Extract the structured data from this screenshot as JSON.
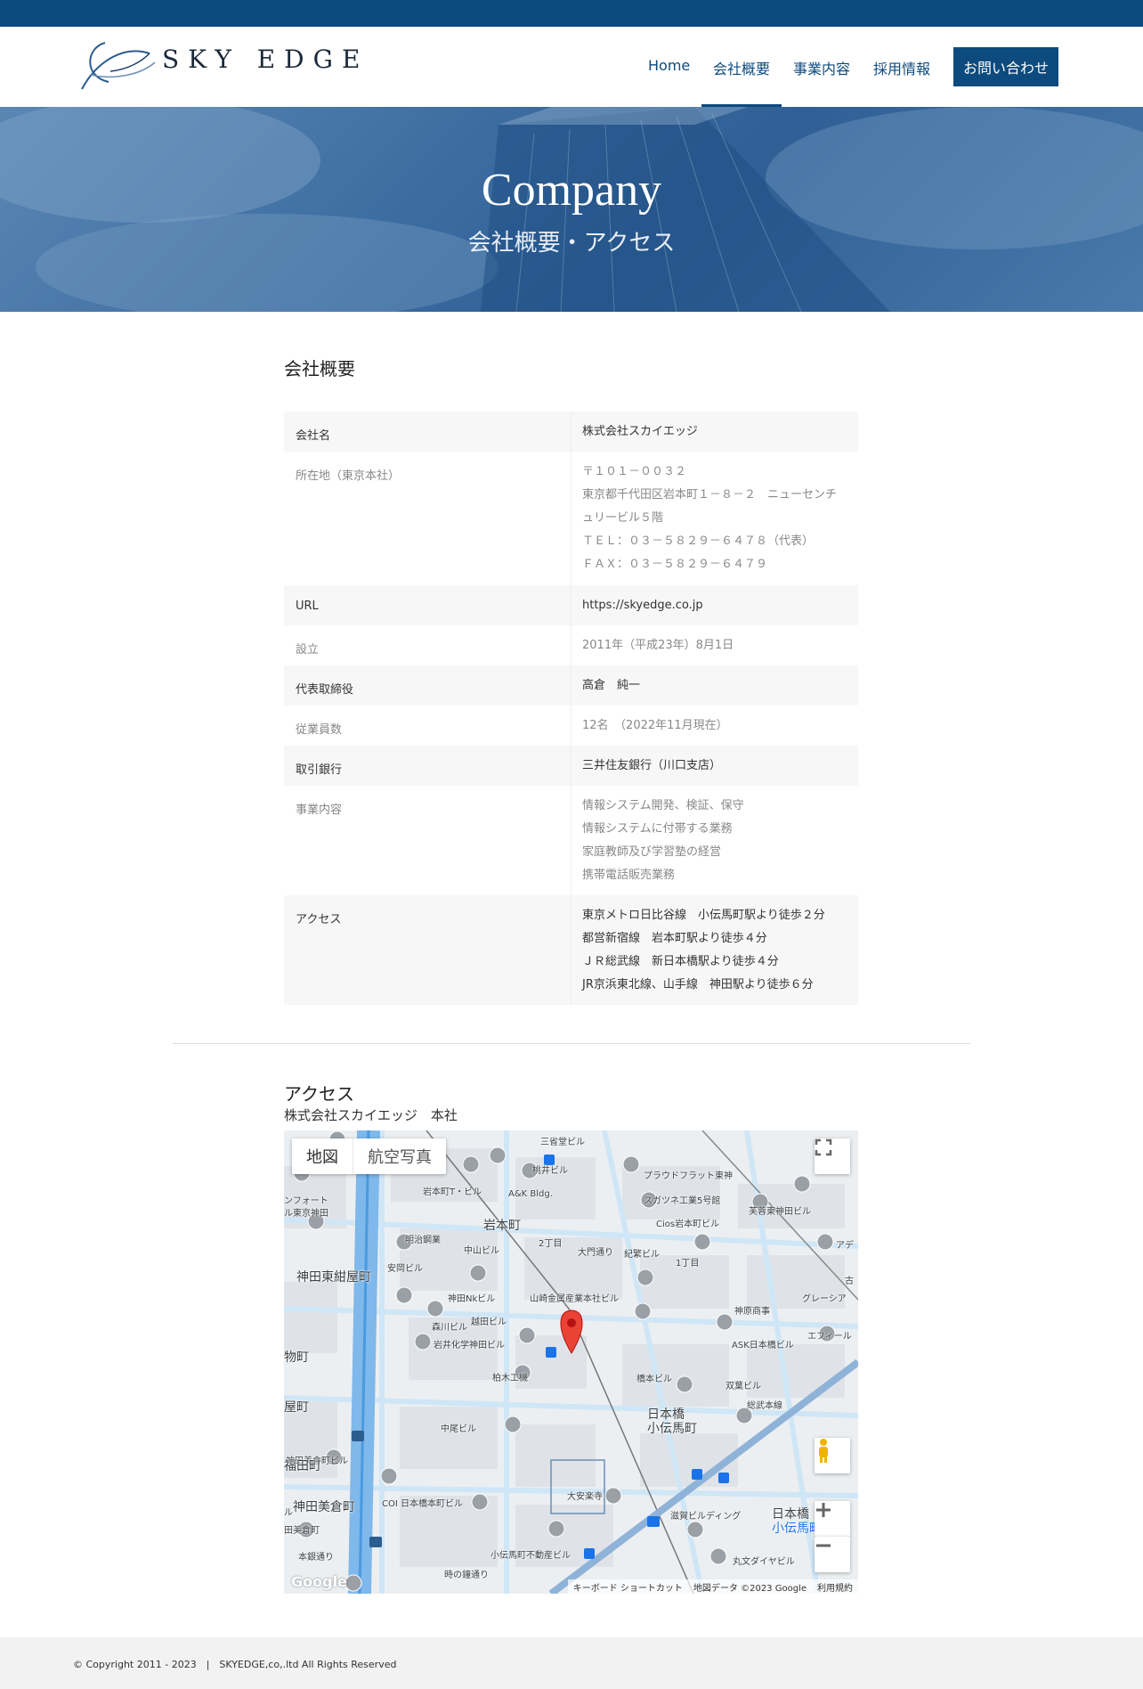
{
  "header": {
    "brand": "SKY EDGE",
    "nav": [
      "Home",
      "会社概要",
      "事業内容",
      "採用情報"
    ],
    "cta": "お問い合わせ"
  },
  "hero": {
    "title": "Company",
    "subtitle": "会社概要・アクセス"
  },
  "overview": {
    "title": "会社概要",
    "rows": [
      {
        "key": "会社名",
        "lines": [
          "株式会社スカイエッジ"
        ]
      },
      {
        "key": "所在地（東京本社）",
        "lines": [
          "〒１０１－００３２",
          "東京都千代田区岩本町１－８－２　ニューセンチ",
          "ュリービル５階",
          "ＴＥＬ：０３－５８２９－６４７８（代表）",
          "ＦＡＸ：０３－５８２９－６４７９"
        ]
      },
      {
        "key": "URL",
        "lines": [
          "https://skyedge.co.jp"
        ]
      },
      {
        "key": "設立",
        "lines": [
          "2011年（平成23年）8月1日"
        ]
      },
      {
        "key": "代表取締役",
        "lines": [
          "高倉　純一"
        ]
      },
      {
        "key": "従業員数",
        "lines": [
          "12名　（2022年11月現在）"
        ]
      },
      {
        "key": "取引銀行",
        "lines": [
          "三井住友銀行（川口支店）"
        ]
      },
      {
        "key": "事業内容",
        "lines": [
          "情報システム開発、検証、保守",
          "情報システムに付帯する業務",
          "家庭教師及び学習塾の経営",
          "携帯電話販売業務"
        ]
      },
      {
        "key": "アクセス",
        "lines": [
          "東京メトロ日比谷線　小伝馬町駅より徒歩２分",
          "都営新宿線　岩本町駅より徒歩４分",
          "ＪＲ総武線　新日本橋駅より徒歩４分",
          "JR京浜東北線、山手線　神田駅より徒歩６分"
        ]
      }
    ]
  },
  "access": {
    "title": "アクセス",
    "subtitle": "株式会社スカイエッジ　本社",
    "map": {
      "type_buttons": [
        "地図",
        "航空写真"
      ],
      "footer": [
        "キーボード ショートカット",
        "地図データ ©2023 Google",
        "利用規約"
      ],
      "google": "Google",
      "labels": [
        "三省堂ビル",
        "桃井ビル",
        "プラウドフラット東神",
        "岩本町T・ビル",
        "A&K Bldg.",
        "スガツネ工業5号館",
        "Cios岩本町ビル",
        "芙蓉東神田ビル",
        "岩本町",
        "明治鋼業",
        "2丁目",
        "中山ビル",
        "紀繁ビル",
        "1丁目",
        "神田東紺屋町",
        "安岡ビル",
        "神田Nkビル",
        "山崎金属産業本社ビル",
        "神原商事",
        "グレーシア",
        "森川ビル",
        "越田ビル",
        "岩井化学神田ビル",
        "ASK日本橋ビル",
        "エフィール",
        "柏木工機",
        "橋本ビル",
        "双葉ビル",
        "日本橋",
        "小伝馬町",
        "中尾ビル",
        "神田美倉町ビル",
        "COI 日本橋本町ビル",
        "大安楽寺",
        "滋賀ビルディング",
        "日本橋",
        "小伝馬町",
        "小伝馬町不動産ビル",
        "丸文ダイヤビル",
        "総武本線",
        "大門通り",
        "時の鐘通り",
        "本銀通り",
        "神田美倉町",
        "福田町",
        "屋町",
        "物町",
        "ンフォート",
        "ル東京神田",
        "田美倉町",
        "ル",
        "アデ",
        "古"
      ]
    }
  },
  "footer": {
    "text": "© Copyright 2011 - 2023　|　SKYEDGE,co,.ltd All Rights Reserved"
  },
  "colors": {
    "brand": "#0d4a7d",
    "shade": "#f7f7f7",
    "footer_bg": "#f2f2f2"
  }
}
